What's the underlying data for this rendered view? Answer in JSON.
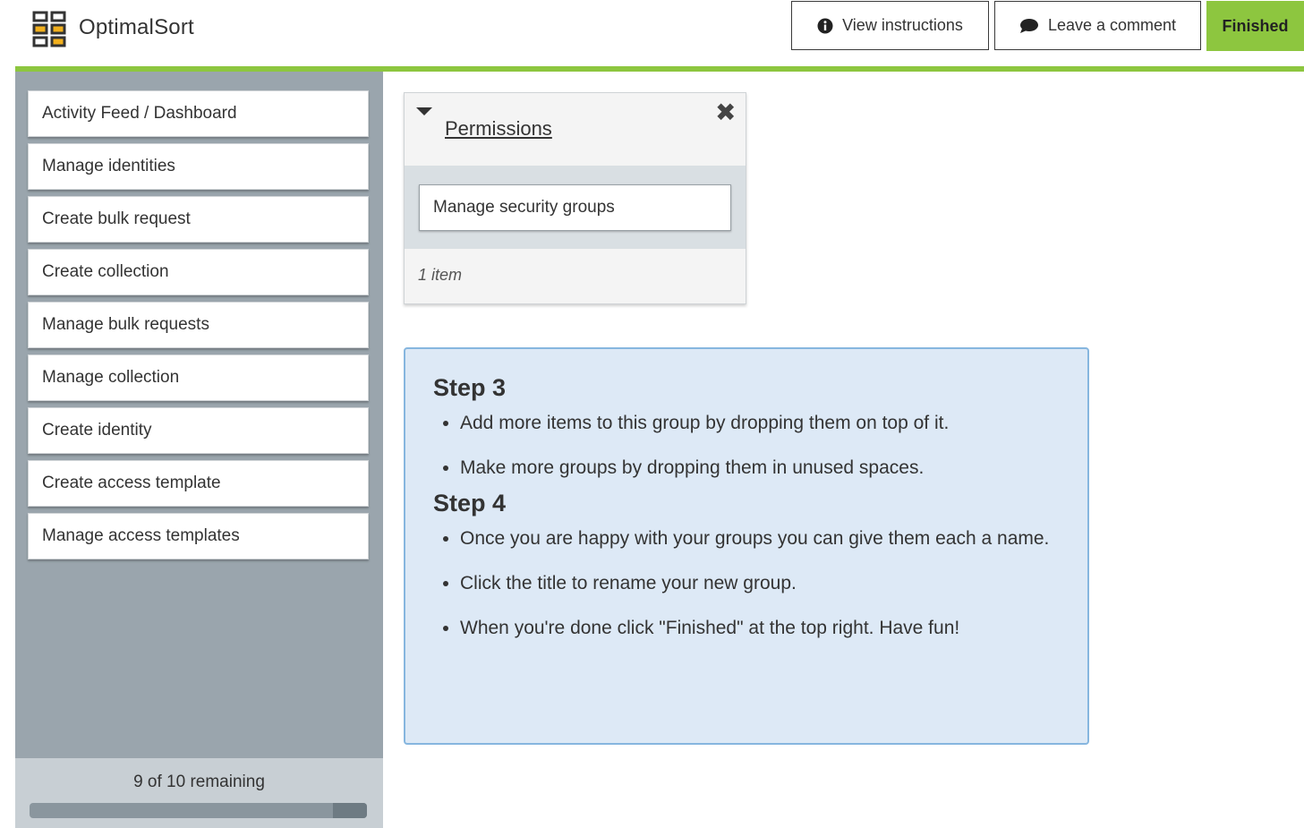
{
  "app": {
    "title": "OptimalSort"
  },
  "header": {
    "view_instructions": "View instructions",
    "leave_comment": "Leave a comment",
    "finished": "Finished"
  },
  "colors": {
    "accent_green": "#8dc63f",
    "sidebar": "#9aa5ad",
    "instructions_bg": "#dde9f6"
  },
  "sidebar": {
    "cards": [
      "Activity Feed / Dashboard",
      "Manage identities",
      "Create bulk request",
      "Create collection",
      "Manage bulk requests",
      "Manage collection",
      "Create identity",
      "Create access template",
      "Manage access templates"
    ],
    "remaining_text": "9 of 10 remaining",
    "progress_fraction": 0.1
  },
  "group": {
    "title": "Permissions",
    "items": [
      "Manage security groups"
    ],
    "count_text": "1 item"
  },
  "instructions": {
    "step3_title": "Step 3",
    "step3_items": [
      "Add more items to this group by dropping them on top of it.",
      "Make more groups by dropping them in unused spaces."
    ],
    "step4_title": "Step 4",
    "step4_items": [
      "Once you are happy with your groups you can give them each a name.",
      "Click the title to rename your new group.",
      "When you're done click \"Finished\" at the top right. Have fun!"
    ]
  }
}
